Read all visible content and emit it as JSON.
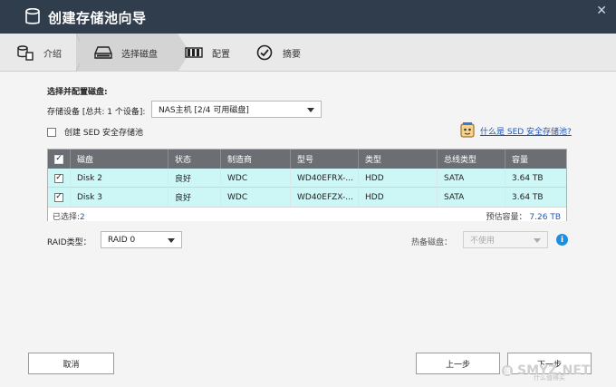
{
  "window": {
    "title": "创建存储池向导",
    "close_glyph": "✕"
  },
  "steps": [
    {
      "label": "介绍",
      "icon": "disks-icon",
      "active": false
    },
    {
      "label": "选择磁盘",
      "icon": "disk-tray-icon",
      "active": true
    },
    {
      "label": "配置",
      "icon": "configure-icon",
      "active": false
    },
    {
      "label": "摘要",
      "icon": "checkmark-circle-icon",
      "active": false
    }
  ],
  "form": {
    "section_label": "选择并配置磁盘:",
    "device_label": "存储设备 [总共: 1 个设备]:",
    "device_value": "NAS主机 [2/4 可用磁盘]",
    "sed_checkbox_label": "创建 SED 安全存储池",
    "sed_link": "什么是 SED 安全存储池?"
  },
  "table": {
    "columns": [
      "磁盘",
      "状态",
      "制造商",
      "型号",
      "类型",
      "总线类型",
      "容量"
    ],
    "rows": [
      {
        "disk": "Disk 2",
        "status": "良好",
        "vendor": "WDC",
        "model": "WD40EFRX-...",
        "type": "HDD",
        "bus": "SATA",
        "capacity": "3.64 TB",
        "checked": true
      },
      {
        "disk": "Disk 3",
        "status": "良好",
        "vendor": "WDC",
        "model": "WD40EFZX-...",
        "type": "HDD",
        "bus": "SATA",
        "capacity": "3.64 TB",
        "checked": true
      }
    ],
    "footer": {
      "selected_label": "已选择:",
      "selected_count": "2",
      "capacity_label": "预估容量：",
      "capacity_value": "7.26 TB"
    }
  },
  "raid": {
    "label": "RAID类型：",
    "value": "RAID 0"
  },
  "spare": {
    "label": "热备磁盘：",
    "value": "不使用"
  },
  "buttons": {
    "cancel": "取消",
    "prev": "上一步",
    "next": "下一步"
  },
  "watermark": {
    "main": "SMYZ.NET",
    "sub": "什么值得买"
  },
  "colors": {
    "titlebar": "#2f3d4c",
    "row_selected": "#cdf6f6",
    "header": "#6b6f73",
    "link": "#1f55b5",
    "info": "#1c8ee0"
  }
}
